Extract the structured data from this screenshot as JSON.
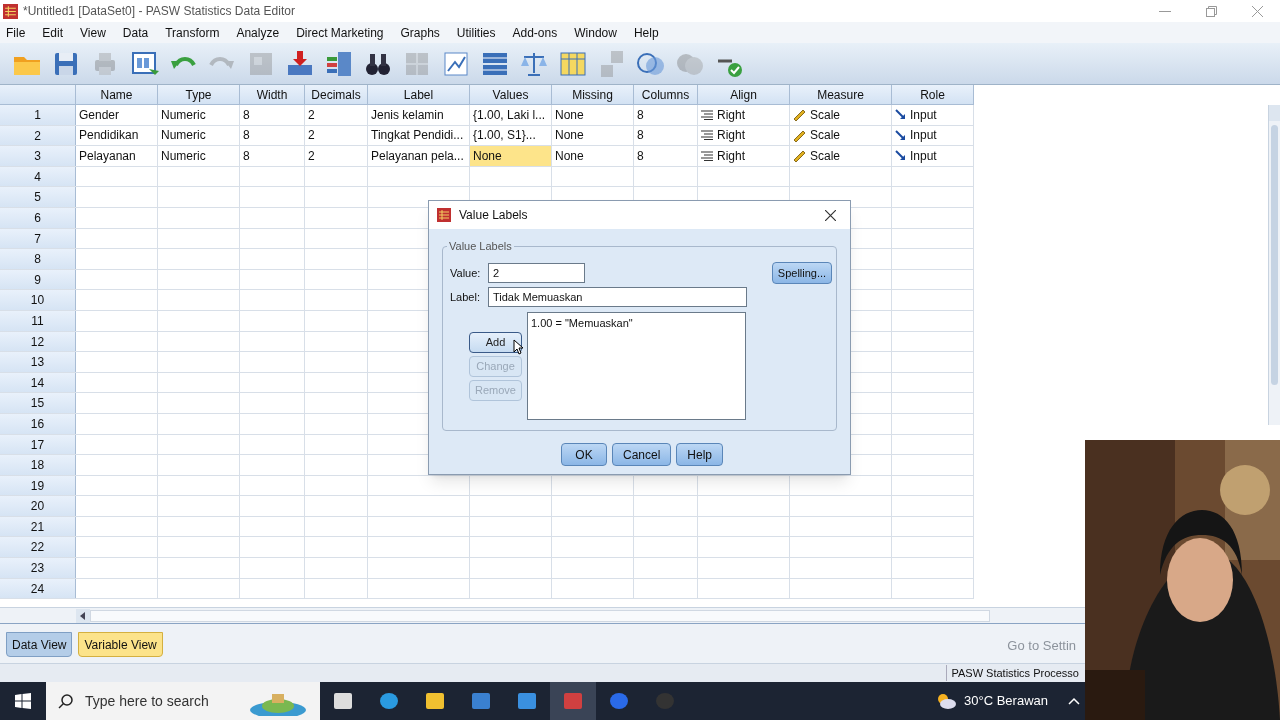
{
  "window": {
    "title": "*Untitled1 [DataSet0] - PASW Statistics Data Editor"
  },
  "menu": [
    "File",
    "Edit",
    "View",
    "Data",
    "Transform",
    "Analyze",
    "Direct Marketing",
    "Graphs",
    "Utilities",
    "Add-ons",
    "Window",
    "Help"
  ],
  "table": {
    "columns": [
      "Name",
      "Type",
      "Width",
      "Decimals",
      "Label",
      "Values",
      "Missing",
      "Columns",
      "Align",
      "Measure",
      "Role"
    ],
    "rows": [
      {
        "number": "1",
        "cells": [
          {
            "text": "Gender",
            "selected": false
          },
          {
            "text": "Numeric",
            "selected": false
          },
          {
            "text": "8",
            "selected": false
          },
          {
            "text": "2",
            "selected": false
          },
          {
            "text": "Jenis kelamin",
            "selected": false
          },
          {
            "text": "{1.00, Laki l...",
            "selected": false
          },
          {
            "text": "None",
            "selected": false
          },
          {
            "text": "8",
            "selected": false
          },
          {
            "text": "Right",
            "selected": false
          },
          {
            "text": "Scale",
            "selected": false
          },
          {
            "text": "Input",
            "selected": false
          }
        ]
      },
      {
        "number": "2",
        "cells": [
          {
            "text": "Pendidikan",
            "selected": false
          },
          {
            "text": "Numeric",
            "selected": false
          },
          {
            "text": "8",
            "selected": false
          },
          {
            "text": "2",
            "selected": false
          },
          {
            "text": "Tingkat Pendidi...",
            "selected": false
          },
          {
            "text": "{1.00, S1}...",
            "selected": false
          },
          {
            "text": "None",
            "selected": false
          },
          {
            "text": "8",
            "selected": false
          },
          {
            "text": "Right",
            "selected": false
          },
          {
            "text": "Scale",
            "selected": false
          },
          {
            "text": "Input",
            "selected": false
          }
        ]
      },
      {
        "number": "3",
        "cells": [
          {
            "text": "Pelayanan",
            "selected": false
          },
          {
            "text": "Numeric",
            "selected": false
          },
          {
            "text": "8",
            "selected": false
          },
          {
            "text": "2",
            "selected": false
          },
          {
            "text": "Pelayanan pela...",
            "selected": false
          },
          {
            "text": "None",
            "selected": true
          },
          {
            "text": "None",
            "selected": false
          },
          {
            "text": "8",
            "selected": false
          },
          {
            "text": "Right",
            "selected": false
          },
          {
            "text": "Scale",
            "selected": false
          },
          {
            "text": "Input",
            "selected": false
          }
        ]
      },
      {
        "number": "4"
      },
      {
        "number": "5"
      },
      {
        "number": "6"
      },
      {
        "number": "7"
      },
      {
        "number": "8"
      },
      {
        "number": "9"
      },
      {
        "number": "10"
      },
      {
        "number": "11"
      },
      {
        "number": "12"
      },
      {
        "number": "13"
      },
      {
        "number": "14"
      },
      {
        "number": "15"
      },
      {
        "number": "16"
      },
      {
        "number": "17"
      },
      {
        "number": "18"
      },
      {
        "number": "19"
      },
      {
        "number": "20"
      },
      {
        "number": "21"
      },
      {
        "number": "22"
      },
      {
        "number": "23"
      },
      {
        "number": "24"
      }
    ]
  },
  "view_tabs": [
    {
      "label": "Data View",
      "selected": false
    },
    {
      "label": "Variable View",
      "selected": true
    }
  ],
  "watermark_text": "Go to Settin",
  "status_bar": "PASW Statistics Processo",
  "dialog": {
    "title": "Value Labels",
    "group": "Value Labels",
    "value_label": "Value:",
    "value": "2",
    "label_label": "Label:",
    "label": "Tidak Memuaskan",
    "list": [
      "1.00 = \"Memuaskan\""
    ],
    "side_buttons": [
      {
        "label": "Add",
        "disabled": false
      },
      {
        "label": "Change",
        "disabled": true
      },
      {
        "label": "Remove",
        "disabled": true
      }
    ],
    "spelling": "Spelling...",
    "buttons": [
      "OK",
      "Cancel",
      "Help"
    ]
  },
  "taskbar": {
    "search_placeholder": "Type here to search",
    "weather": "30°C Berawan"
  }
}
